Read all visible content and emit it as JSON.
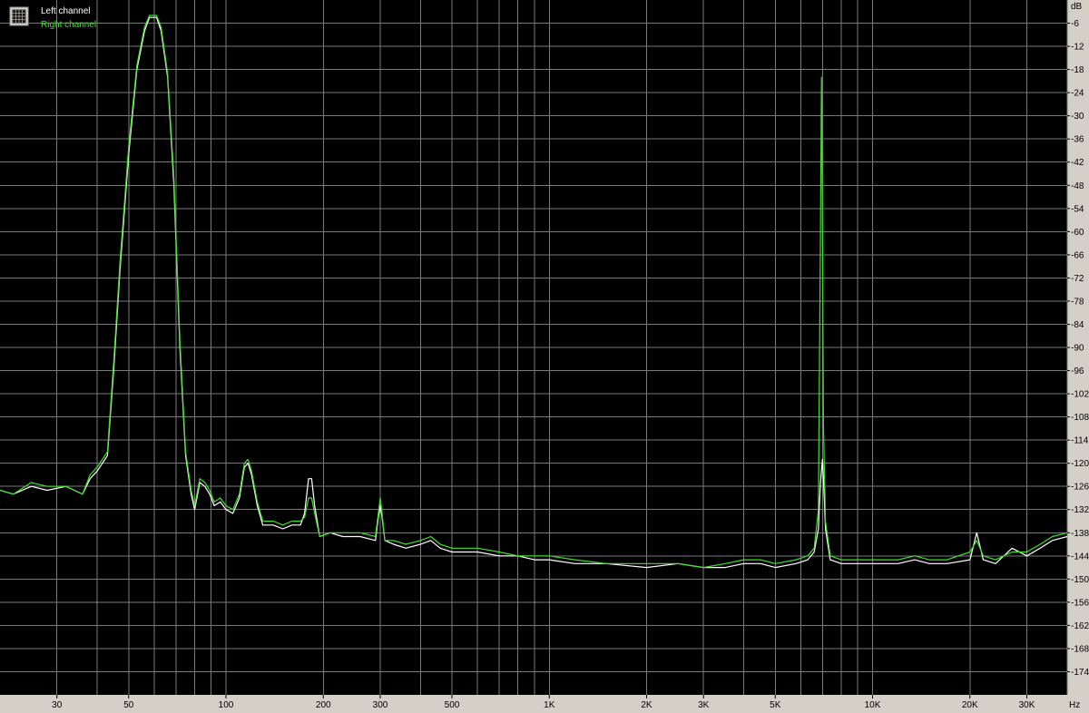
{
  "chart_data": {
    "type": "line",
    "title": "",
    "xlabel": "",
    "ylabel": "",
    "x_unit": "Hz",
    "y_unit": "dB",
    "x_scale": "log",
    "xlim": [
      20,
      40000
    ],
    "ylim": [
      -180,
      0
    ],
    "grid": true,
    "legend_position": "top-left",
    "background_color": "#000000",
    "frame_color": "#d4d0c8",
    "grid_color": "#7a7a7a",
    "x_ticks": [
      {
        "value": 30,
        "label": "30"
      },
      {
        "value": 50,
        "label": "50"
      },
      {
        "value": 100,
        "label": "100"
      },
      {
        "value": 200,
        "label": "200"
      },
      {
        "value": 300,
        "label": "300"
      },
      {
        "value": 500,
        "label": "500"
      },
      {
        "value": 1000,
        "label": "1K"
      },
      {
        "value": 2000,
        "label": "2K"
      },
      {
        "value": 3000,
        "label": "3K"
      },
      {
        "value": 5000,
        "label": "5K"
      },
      {
        "value": 10000,
        "label": "10K"
      },
      {
        "value": 20000,
        "label": "20K"
      },
      {
        "value": 30000,
        "label": "30K"
      }
    ],
    "x_minor_grid": [
      40,
      60,
      70,
      80,
      90,
      400,
      600,
      700,
      800,
      900,
      4000,
      6000,
      7000,
      8000,
      9000,
      40000
    ],
    "y_ticks": [
      -6,
      -12,
      -18,
      -24,
      -30,
      -36,
      -42,
      -48,
      -54,
      -60,
      -66,
      -72,
      -78,
      -84,
      -90,
      -96,
      -102,
      -108,
      -114,
      -120,
      -126,
      -132,
      -138,
      -144,
      -150,
      -156,
      -162,
      -168,
      -174
    ],
    "series": [
      {
        "name": "Left channel",
        "color": "#ffffff",
        "points": [
          [
            20,
            -127
          ],
          [
            22,
            -128
          ],
          [
            25,
            -126
          ],
          [
            28,
            -127
          ],
          [
            32,
            -126
          ],
          [
            36,
            -128
          ],
          [
            38,
            -124
          ],
          [
            40,
            -122
          ],
          [
            43,
            -118
          ],
          [
            45,
            -95
          ],
          [
            47,
            -70
          ],
          [
            50,
            -40
          ],
          [
            53,
            -18
          ],
          [
            56,
            -8
          ],
          [
            58,
            -4.5
          ],
          [
            61,
            -4.5
          ],
          [
            63,
            -8
          ],
          [
            66,
            -20
          ],
          [
            69,
            -48
          ],
          [
            72,
            -90
          ],
          [
            75,
            -118
          ],
          [
            78,
            -128
          ],
          [
            80,
            -132
          ],
          [
            83,
            -125
          ],
          [
            86,
            -126
          ],
          [
            89,
            -128
          ],
          [
            92,
            -131
          ],
          [
            96,
            -130
          ],
          [
            100,
            -132
          ],
          [
            105,
            -133
          ],
          [
            110,
            -129
          ],
          [
            114,
            -121
          ],
          [
            117,
            -120
          ],
          [
            120,
            -123
          ],
          [
            125,
            -131
          ],
          [
            130,
            -136
          ],
          [
            140,
            -136
          ],
          [
            150,
            -137
          ],
          [
            160,
            -136
          ],
          [
            170,
            -136
          ],
          [
            175,
            -133
          ],
          [
            180,
            -124
          ],
          [
            184,
            -124
          ],
          [
            188,
            -131
          ],
          [
            195,
            -139
          ],
          [
            210,
            -138
          ],
          [
            230,
            -139
          ],
          [
            260,
            -139
          ],
          [
            290,
            -140
          ],
          [
            296,
            -134
          ],
          [
            300,
            -131
          ],
          [
            304,
            -134
          ],
          [
            310,
            -140
          ],
          [
            330,
            -141
          ],
          [
            360,
            -142
          ],
          [
            400,
            -141
          ],
          [
            430,
            -140
          ],
          [
            460,
            -142
          ],
          [
            500,
            -143
          ],
          [
            600,
            -143
          ],
          [
            700,
            -144
          ],
          [
            800,
            -144
          ],
          [
            900,
            -145
          ],
          [
            1000,
            -145
          ],
          [
            1200,
            -146
          ],
          [
            1500,
            -146
          ],
          [
            2000,
            -147
          ],
          [
            2500,
            -146
          ],
          [
            3000,
            -147
          ],
          [
            3500,
            -147
          ],
          [
            4000,
            -146
          ],
          [
            4500,
            -146
          ],
          [
            5000,
            -147
          ],
          [
            5800,
            -146
          ],
          [
            6300,
            -145
          ],
          [
            6600,
            -143
          ],
          [
            6800,
            -137
          ],
          [
            6900,
            -125
          ],
          [
            7000,
            -119
          ],
          [
            7050,
            -124
          ],
          [
            7150,
            -137
          ],
          [
            7400,
            -145
          ],
          [
            8000,
            -146
          ],
          [
            9000,
            -146
          ],
          [
            10000,
            -146
          ],
          [
            12000,
            -146
          ],
          [
            13500,
            -145
          ],
          [
            15000,
            -146
          ],
          [
            17000,
            -146
          ],
          [
            20000,
            -145
          ],
          [
            21000,
            -138
          ],
          [
            22000,
            -145
          ],
          [
            24000,
            -146
          ],
          [
            27000,
            -142
          ],
          [
            30000,
            -144
          ],
          [
            33000,
            -142
          ],
          [
            36000,
            -140
          ],
          [
            40000,
            -139
          ]
        ]
      },
      {
        "name": "Right channel",
        "color": "#3fe02b",
        "points": [
          [
            20,
            -127
          ],
          [
            22,
            -128
          ],
          [
            25,
            -125
          ],
          [
            28,
            -126
          ],
          [
            32,
            -126
          ],
          [
            36,
            -128
          ],
          [
            38,
            -123
          ],
          [
            40,
            -121
          ],
          [
            43,
            -117
          ],
          [
            45,
            -93
          ],
          [
            47,
            -68
          ],
          [
            50,
            -38
          ],
          [
            53,
            -17
          ],
          [
            56,
            -7
          ],
          [
            58,
            -4
          ],
          [
            61,
            -4
          ],
          [
            63,
            -7
          ],
          [
            66,
            -19
          ],
          [
            69,
            -46
          ],
          [
            72,
            -88
          ],
          [
            75,
            -117
          ],
          [
            78,
            -127
          ],
          [
            80,
            -131
          ],
          [
            83,
            -124
          ],
          [
            86,
            -125
          ],
          [
            89,
            -127
          ],
          [
            92,
            -130
          ],
          [
            96,
            -129
          ],
          [
            100,
            -131
          ],
          [
            105,
            -132
          ],
          [
            110,
            -128
          ],
          [
            114,
            -120
          ],
          [
            117,
            -119
          ],
          [
            120,
            -122
          ],
          [
            125,
            -130
          ],
          [
            130,
            -135
          ],
          [
            140,
            -135
          ],
          [
            150,
            -136
          ],
          [
            160,
            -135
          ],
          [
            170,
            -135
          ],
          [
            175,
            -134
          ],
          [
            180,
            -129
          ],
          [
            184,
            -129
          ],
          [
            188,
            -133
          ],
          [
            195,
            -139
          ],
          [
            210,
            -138
          ],
          [
            230,
            -138
          ],
          [
            260,
            -138
          ],
          [
            290,
            -139
          ],
          [
            296,
            -133
          ],
          [
            300,
            -129
          ],
          [
            304,
            -133
          ],
          [
            310,
            -140
          ],
          [
            330,
            -140
          ],
          [
            360,
            -141
          ],
          [
            400,
            -140
          ],
          [
            430,
            -139
          ],
          [
            460,
            -141
          ],
          [
            500,
            -142
          ],
          [
            600,
            -142
          ],
          [
            700,
            -143
          ],
          [
            800,
            -144
          ],
          [
            900,
            -144
          ],
          [
            1000,
            -144
          ],
          [
            1200,
            -145
          ],
          [
            1500,
            -146
          ],
          [
            2000,
            -146
          ],
          [
            2500,
            -146
          ],
          [
            3000,
            -147
          ],
          [
            3500,
            -146
          ],
          [
            4000,
            -145
          ],
          [
            4500,
            -145
          ],
          [
            5000,
            -146
          ],
          [
            5800,
            -145
          ],
          [
            6300,
            -144
          ],
          [
            6600,
            -142
          ],
          [
            6800,
            -132
          ],
          [
            6900,
            -60
          ],
          [
            6950,
            -20
          ],
          [
            7000,
            -60
          ],
          [
            7050,
            -110
          ],
          [
            7150,
            -135
          ],
          [
            7400,
            -144
          ],
          [
            8000,
            -145
          ],
          [
            9000,
            -145
          ],
          [
            10000,
            -145
          ],
          [
            12000,
            -145
          ],
          [
            13500,
            -144
          ],
          [
            15000,
            -145
          ],
          [
            17000,
            -145
          ],
          [
            20000,
            -143
          ],
          [
            21000,
            -140
          ],
          [
            22000,
            -144
          ],
          [
            24000,
            -145
          ],
          [
            27000,
            -143
          ],
          [
            30000,
            -143
          ],
          [
            33000,
            -141
          ],
          [
            36000,
            -139
          ],
          [
            40000,
            -138
          ]
        ]
      }
    ]
  }
}
